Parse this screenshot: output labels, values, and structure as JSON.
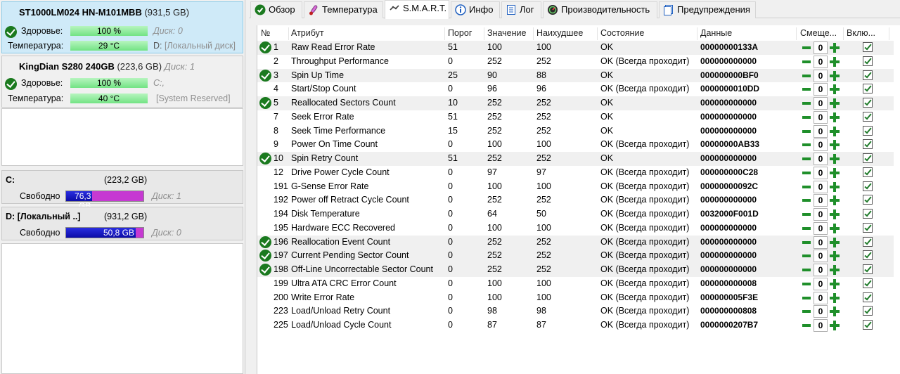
{
  "left": {
    "disks": [
      {
        "name": "ST1000LM024 HN-M101MBB",
        "size": "(931,5 GB)",
        "disk_tag": "",
        "health_label": "Здоровье:",
        "health_value": "100 %",
        "health_disk": "Диск: 0",
        "temp_label": "Температура:",
        "temp_value": "29 °C",
        "volume_prefix": "D:",
        "volume": "[Локальный диск]"
      },
      {
        "name": "KingDian S280 240GB",
        "size": "(223,6 GB)",
        "disk_tag": "Диск: 1",
        "health_label": "Здоровье:",
        "health_value": "100 %",
        "health_disk": "C:,",
        "temp_label": "Температура:",
        "temp_value": "40 °C",
        "volume_prefix": "",
        "volume": "[System Reserved]"
      }
    ],
    "volumes": [
      {
        "name": "C:",
        "size": "(223,2 GB)",
        "free_label": "Свободно",
        "free_value": "76,3 GB",
        "free_fraction": 0.34,
        "disk": "Диск: 1"
      },
      {
        "name": "D: [Локальный ..]",
        "size": "(931,2 GB)",
        "free_label": "Свободно",
        "free_value": "50,8 GB",
        "free_fraction": 0.9,
        "disk": "Диск: 0"
      }
    ]
  },
  "tabs": [
    "Обзор",
    "Температура",
    "S.M.A.R.T.",
    "Инфо",
    "Лог",
    "Производительность",
    "Предупреждения"
  ],
  "active_tab": "S.M.A.R.T.",
  "table": {
    "headers": {
      "num": "№",
      "attr": "Атрибут",
      "threshold": "Порог",
      "value": "Значение",
      "worst": "Наихудшее",
      "state": "Состояние",
      "data": "Данные",
      "offset": "Смеще...",
      "enabled": "Вклю..."
    },
    "rows": [
      {
        "ok": true,
        "num": "1",
        "attr": "Raw Read Error Rate",
        "thr": "51",
        "val": "100",
        "worst": "100",
        "state": "OK",
        "data": "00000000133A",
        "offset": "0"
      },
      {
        "ok": false,
        "num": "2",
        "attr": "Throughput Performance",
        "thr": "0",
        "val": "252",
        "worst": "252",
        "state": "OK (Всегда проходит)",
        "data": "000000000000",
        "offset": "0"
      },
      {
        "ok": true,
        "num": "3",
        "attr": "Spin Up Time",
        "thr": "25",
        "val": "90",
        "worst": "88",
        "state": "OK",
        "data": "000000000BF0",
        "offset": "0"
      },
      {
        "ok": false,
        "num": "4",
        "attr": "Start/Stop Count",
        "thr": "0",
        "val": "96",
        "worst": "96",
        "state": "OK (Всегда проходит)",
        "data": "0000000010DD",
        "offset": "0"
      },
      {
        "ok": true,
        "num": "5",
        "attr": "Reallocated Sectors Count",
        "thr": "10",
        "val": "252",
        "worst": "252",
        "state": "OK",
        "data": "000000000000",
        "offset": "0"
      },
      {
        "ok": false,
        "num": "7",
        "attr": "Seek Error Rate",
        "thr": "51",
        "val": "252",
        "worst": "252",
        "state": "OK",
        "data": "000000000000",
        "offset": "0"
      },
      {
        "ok": false,
        "num": "8",
        "attr": "Seek Time Performance",
        "thr": "15",
        "val": "252",
        "worst": "252",
        "state": "OK",
        "data": "000000000000",
        "offset": "0"
      },
      {
        "ok": false,
        "num": "9",
        "attr": "Power On Time Count",
        "thr": "0",
        "val": "100",
        "worst": "100",
        "state": "OK (Всегда проходит)",
        "data": "00000000AB33",
        "offset": "0"
      },
      {
        "ok": true,
        "num": "10",
        "attr": "Spin Retry Count",
        "thr": "51",
        "val": "252",
        "worst": "252",
        "state": "OK",
        "data": "000000000000",
        "offset": "0"
      },
      {
        "ok": false,
        "num": "12",
        "attr": "Drive Power Cycle Count",
        "thr": "0",
        "val": "97",
        "worst": "97",
        "state": "OK (Всегда проходит)",
        "data": "000000000C28",
        "offset": "0"
      },
      {
        "ok": false,
        "num": "191",
        "attr": "G-Sense Error Rate",
        "thr": "0",
        "val": "100",
        "worst": "100",
        "state": "OK (Всегда проходит)",
        "data": "00000000092C",
        "offset": "0"
      },
      {
        "ok": false,
        "num": "192",
        "attr": "Power off Retract Cycle Count",
        "thr": "0",
        "val": "252",
        "worst": "252",
        "state": "OK (Всегда проходит)",
        "data": "000000000000",
        "offset": "0"
      },
      {
        "ok": false,
        "num": "194",
        "attr": "Disk Temperature",
        "thr": "0",
        "val": "64",
        "worst": "50",
        "state": "OK (Всегда проходит)",
        "data": "0032000F001D",
        "offset": "0"
      },
      {
        "ok": false,
        "num": "195",
        "attr": "Hardware ECC Recovered",
        "thr": "0",
        "val": "100",
        "worst": "100",
        "state": "OK (Всегда проходит)",
        "data": "000000000000",
        "offset": "0"
      },
      {
        "ok": true,
        "num": "196",
        "attr": "Reallocation Event Count",
        "thr": "0",
        "val": "252",
        "worst": "252",
        "state": "OK (Всегда проходит)",
        "data": "000000000000",
        "offset": "0"
      },
      {
        "ok": true,
        "num": "197",
        "attr": "Current Pending Sector Count",
        "thr": "0",
        "val": "252",
        "worst": "252",
        "state": "OK (Всегда проходит)",
        "data": "000000000000",
        "offset": "0"
      },
      {
        "ok": true,
        "num": "198",
        "attr": "Off-Line Uncorrectable Sector Count",
        "thr": "0",
        "val": "252",
        "worst": "252",
        "state": "OK (Всегда проходит)",
        "data": "000000000000",
        "offset": "0"
      },
      {
        "ok": false,
        "num": "199",
        "attr": "Ultra ATA CRC Error Count",
        "thr": "0",
        "val": "100",
        "worst": "100",
        "state": "OK (Всегда проходит)",
        "data": "000000000008",
        "offset": "0"
      },
      {
        "ok": false,
        "num": "200",
        "attr": "Write Error Rate",
        "thr": "0",
        "val": "100",
        "worst": "100",
        "state": "OK (Всегда проходит)",
        "data": "000000005F3E",
        "offset": "0"
      },
      {
        "ok": false,
        "num": "223",
        "attr": "Load/Unload Retry Count",
        "thr": "0",
        "val": "98",
        "worst": "98",
        "state": "OK (Всегда проходит)",
        "data": "000000000808",
        "offset": "0"
      },
      {
        "ok": false,
        "num": "225",
        "attr": "Load/Unload Cycle Count",
        "thr": "0",
        "val": "87",
        "worst": "87",
        "state": "OK (Всегда проходит)",
        "data": "0000000207B7",
        "offset": "0"
      }
    ]
  }
}
